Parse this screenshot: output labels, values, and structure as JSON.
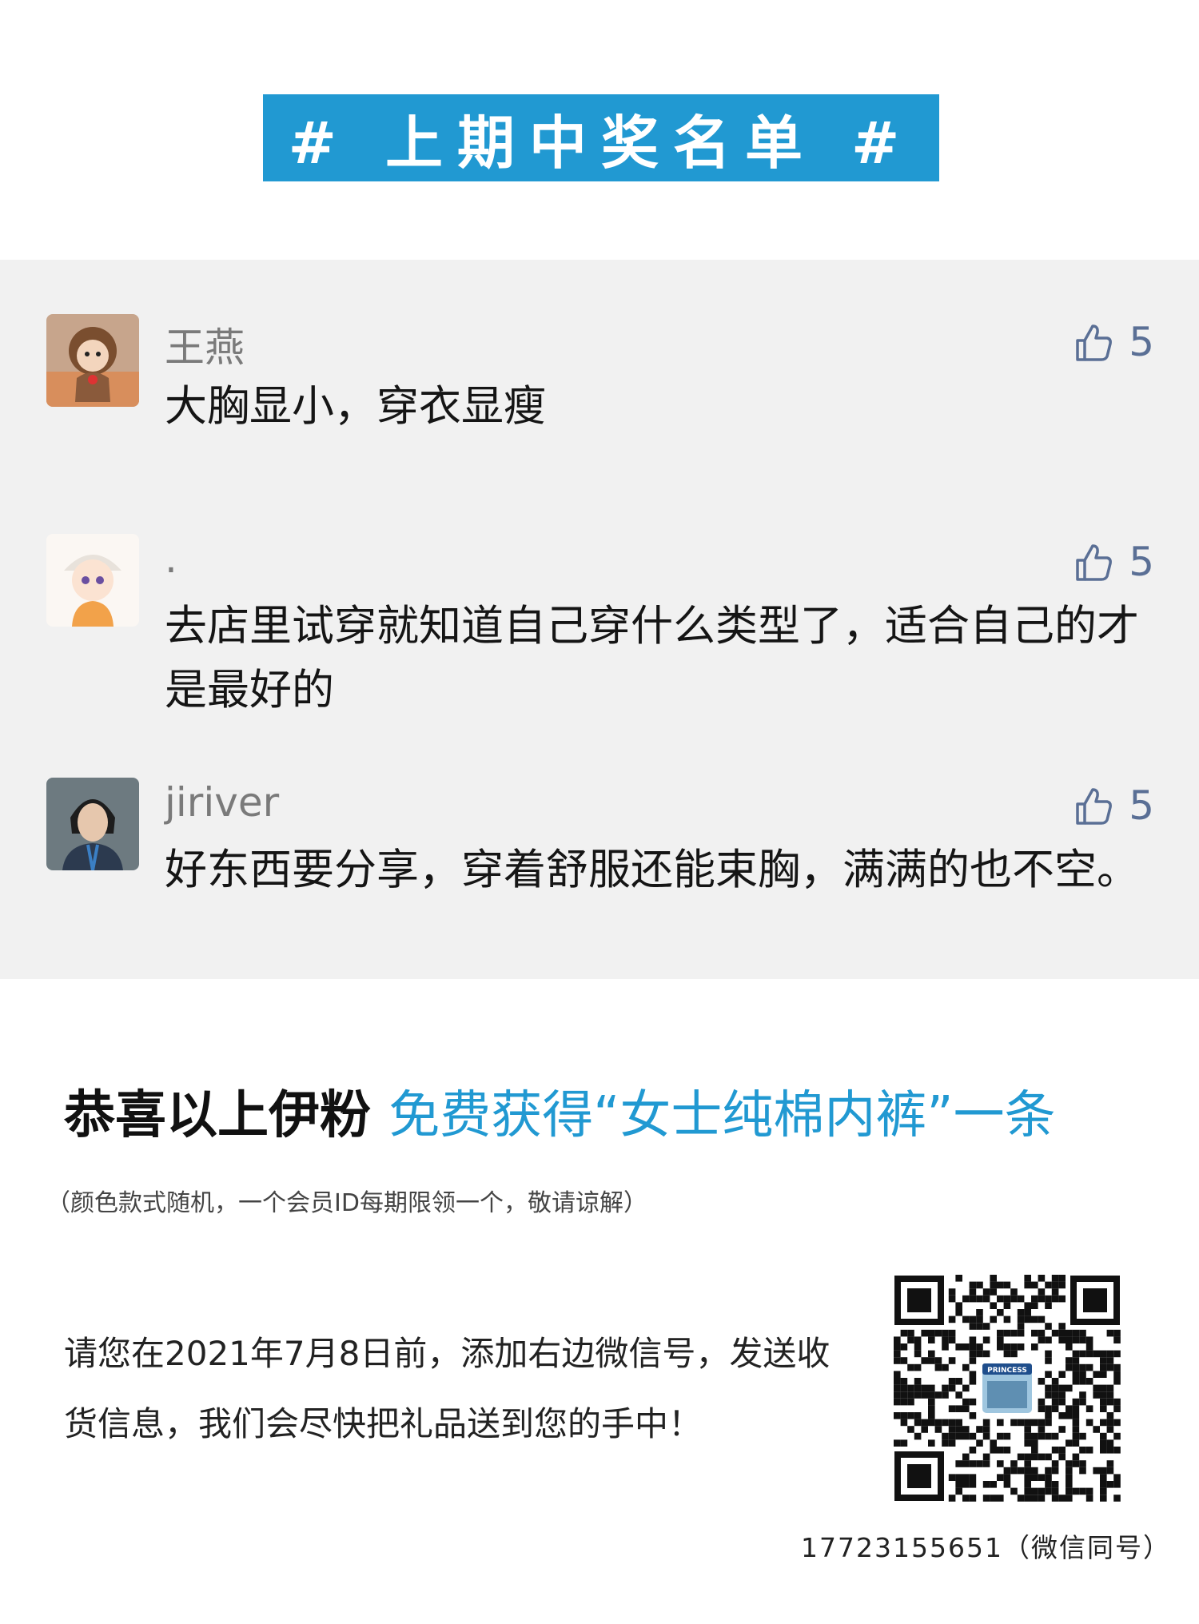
{
  "banner": {
    "title": "# 上期中奖名单 #"
  },
  "comments": [
    {
      "name": "王燕",
      "likes": "5",
      "text": "大胸显小，穿衣显瘦"
    },
    {
      "name": ".",
      "likes": "5",
      "text": "去店里试穿就知道自己穿什么类型了，适合自己的才是最好的"
    },
    {
      "name": "jiriver",
      "likes": "5",
      "text": "好东西要分享，穿着舒服还能束胸，满满的也不空。"
    }
  ],
  "congrats": {
    "black": "恭喜以上伊粉 ",
    "blue": "免费获得“女士纯棉内裤”一条"
  },
  "note": "（颜色款式随机，一个会员ID每期限领一个，敬请谅解）",
  "instructions": "请您在2021年7月8日前，添加右边微信号，发送收货信息，我们会尽快把礼品送到您的手中！",
  "qr": {
    "center_text": "PRINCESS"
  },
  "phone": "17723155651（微信同号）",
  "colors": {
    "accent": "#2199d2",
    "like": "#5a6f95",
    "panel": "#f1f1f1"
  }
}
